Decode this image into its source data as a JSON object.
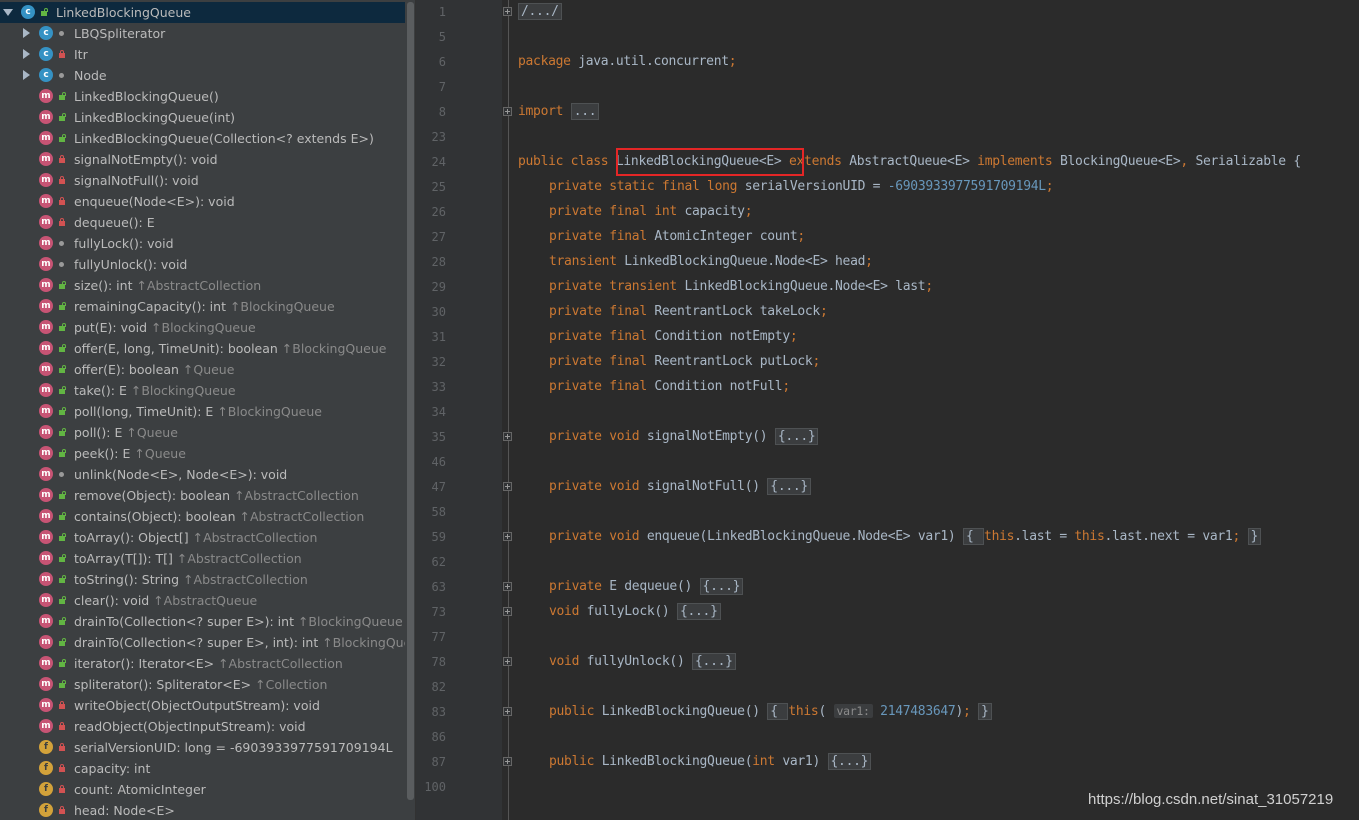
{
  "structure": {
    "items": [
      {
        "label": "LinkedBlockingQueue",
        "inherit": "",
        "kind": "c",
        "vis": "open",
        "depth": 0,
        "arrow": "down",
        "selected": true
      },
      {
        "label": "LBQSpliterator",
        "inherit": "",
        "kind": "c",
        "vis": "dot",
        "depth": 1,
        "arrow": "right"
      },
      {
        "label": "Itr",
        "inherit": "",
        "kind": "c",
        "vis": "lock",
        "depth": 1,
        "arrow": "right"
      },
      {
        "label": "Node",
        "inherit": "",
        "kind": "c",
        "vis": "dot",
        "depth": 1,
        "arrow": "right"
      },
      {
        "label": "LinkedBlockingQueue()",
        "inherit": "",
        "kind": "m",
        "vis": "open",
        "depth": 1
      },
      {
        "label": "LinkedBlockingQueue(int)",
        "inherit": "",
        "kind": "m",
        "vis": "open",
        "depth": 1
      },
      {
        "label": "LinkedBlockingQueue(Collection<? extends E>)",
        "inherit": "",
        "kind": "m",
        "vis": "open",
        "depth": 1
      },
      {
        "label": "signalNotEmpty(): void",
        "inherit": "",
        "kind": "m",
        "vis": "lock",
        "depth": 1
      },
      {
        "label": "signalNotFull(): void",
        "inherit": "",
        "kind": "m",
        "vis": "lock",
        "depth": 1
      },
      {
        "label": "enqueue(Node<E>): void",
        "inherit": "",
        "kind": "m",
        "vis": "lock",
        "depth": 1
      },
      {
        "label": "dequeue(): E",
        "inherit": "",
        "kind": "m",
        "vis": "lock",
        "depth": 1
      },
      {
        "label": "fullyLock(): void",
        "inherit": "",
        "kind": "m",
        "vis": "dot",
        "depth": 1
      },
      {
        "label": "fullyUnlock(): void",
        "inherit": "",
        "kind": "m",
        "vis": "dot",
        "depth": 1
      },
      {
        "label": "size(): int ",
        "inherit": "↑AbstractCollection",
        "kind": "m",
        "vis": "open",
        "depth": 1
      },
      {
        "label": "remainingCapacity(): int ",
        "inherit": "↑BlockingQueue",
        "kind": "m",
        "vis": "open",
        "depth": 1
      },
      {
        "label": "put(E): void ",
        "inherit": "↑BlockingQueue",
        "kind": "m",
        "vis": "open",
        "depth": 1
      },
      {
        "label": "offer(E, long, TimeUnit): boolean ",
        "inherit": "↑BlockingQueue",
        "kind": "m",
        "vis": "open",
        "depth": 1
      },
      {
        "label": "offer(E): boolean ",
        "inherit": "↑Queue",
        "kind": "m",
        "vis": "open",
        "depth": 1
      },
      {
        "label": "take(): E ",
        "inherit": "↑BlockingQueue",
        "kind": "m",
        "vis": "open",
        "depth": 1
      },
      {
        "label": "poll(long, TimeUnit): E ",
        "inherit": "↑BlockingQueue",
        "kind": "m",
        "vis": "open",
        "depth": 1
      },
      {
        "label": "poll(): E ",
        "inherit": "↑Queue",
        "kind": "m",
        "vis": "open",
        "depth": 1
      },
      {
        "label": "peek(): E ",
        "inherit": "↑Queue",
        "kind": "m",
        "vis": "open",
        "depth": 1
      },
      {
        "label": "unlink(Node<E>, Node<E>): void",
        "inherit": "",
        "kind": "m",
        "vis": "dot",
        "depth": 1
      },
      {
        "label": "remove(Object): boolean ",
        "inherit": "↑AbstractCollection",
        "kind": "m",
        "vis": "open",
        "depth": 1
      },
      {
        "label": "contains(Object): boolean ",
        "inherit": "↑AbstractCollection",
        "kind": "m",
        "vis": "open",
        "depth": 1
      },
      {
        "label": "toArray(): Object[] ",
        "inherit": "↑AbstractCollection",
        "kind": "m",
        "vis": "open",
        "depth": 1
      },
      {
        "label": "toArray(T[]): T[] ",
        "inherit": "↑AbstractCollection",
        "kind": "m",
        "vis": "open",
        "depth": 1
      },
      {
        "label": "toString(): String ",
        "inherit": "↑AbstractCollection",
        "kind": "m",
        "vis": "open",
        "depth": 1
      },
      {
        "label": "clear(): void ",
        "inherit": "↑AbstractQueue",
        "kind": "m",
        "vis": "open",
        "depth": 1
      },
      {
        "label": "drainTo(Collection<? super E>): int ",
        "inherit": "↑BlockingQueue",
        "kind": "m",
        "vis": "open",
        "depth": 1
      },
      {
        "label": "drainTo(Collection<? super E>, int): int ",
        "inherit": "↑BlockingQueue",
        "kind": "m",
        "vis": "open",
        "depth": 1
      },
      {
        "label": "iterator(): Iterator<E> ",
        "inherit": "↑AbstractCollection",
        "kind": "m",
        "vis": "open",
        "depth": 1
      },
      {
        "label": "spliterator(): Spliterator<E> ",
        "inherit": "↑Collection",
        "kind": "m",
        "vis": "open",
        "depth": 1
      },
      {
        "label": "writeObject(ObjectOutputStream): void",
        "inherit": "",
        "kind": "m",
        "vis": "lock",
        "depth": 1
      },
      {
        "label": "readObject(ObjectInputStream): void",
        "inherit": "",
        "kind": "m",
        "vis": "lock",
        "depth": 1
      },
      {
        "label": "serialVersionUID: long = -6903933977591709194L",
        "inherit": "",
        "kind": "f",
        "vis": "lock",
        "depth": 1
      },
      {
        "label": "capacity: int",
        "inherit": "",
        "kind": "f",
        "vis": "lock",
        "depth": 1
      },
      {
        "label": "count: AtomicInteger",
        "inherit": "",
        "kind": "f",
        "vis": "lock",
        "depth": 1
      },
      {
        "label": "head: Node<E>",
        "inherit": "",
        "kind": "f",
        "vis": "lock",
        "depth": 1
      }
    ]
  },
  "editor": {
    "lines": [
      {
        "num": "1",
        "fold": true,
        "indent": 0,
        "tokens": [
          {
            "t": "/.../",
            "c": "fbox"
          }
        ]
      },
      {
        "num": "5",
        "indent": 0,
        "tokens": []
      },
      {
        "num": "6",
        "indent": 0,
        "tokens": [
          {
            "t": "package",
            "c": "kw"
          },
          {
            "t": " java.util.concurrent"
          },
          {
            "t": ";",
            "c": "kw"
          }
        ]
      },
      {
        "num": "7",
        "indent": 0,
        "tokens": []
      },
      {
        "num": "8",
        "fold": true,
        "indent": 0,
        "tokens": [
          {
            "t": "import",
            "c": "kw"
          },
          {
            "t": " "
          },
          {
            "t": "...",
            "c": "fbox"
          }
        ]
      },
      {
        "num": "23",
        "indent": 0,
        "tokens": []
      },
      {
        "num": "24",
        "indent": 0,
        "tokens": [
          {
            "t": "public class ",
            "c": "kw"
          },
          {
            "t": "LinkedBlockingQueue<E> "
          },
          {
            "t": "extends ",
            "c": "kw"
          },
          {
            "t": "AbstractQueue<E> "
          },
          {
            "t": "implements ",
            "c": "kw"
          },
          {
            "t": "BlockingQueue<E>"
          },
          {
            "t": ", ",
            "c": "kw"
          },
          {
            "t": "Serializable {"
          }
        ]
      },
      {
        "num": "25",
        "indent": 1,
        "tokens": [
          {
            "t": "private static final long ",
            "c": "kw"
          },
          {
            "t": "serialVersionUID = "
          },
          {
            "t": "-6903933977591709194L",
            "c": "num"
          },
          {
            "t": ";",
            "c": "kw"
          }
        ]
      },
      {
        "num": "26",
        "indent": 1,
        "tokens": [
          {
            "t": "private final int ",
            "c": "kw"
          },
          {
            "t": "capacity"
          },
          {
            "t": ";",
            "c": "kw"
          }
        ]
      },
      {
        "num": "27",
        "indent": 1,
        "tokens": [
          {
            "t": "private final ",
            "c": "kw"
          },
          {
            "t": "AtomicInteger count"
          },
          {
            "t": ";",
            "c": "kw"
          }
        ]
      },
      {
        "num": "28",
        "indent": 1,
        "tokens": [
          {
            "t": "transient ",
            "c": "kw"
          },
          {
            "t": "LinkedBlockingQueue.Node<E> head"
          },
          {
            "t": ";",
            "c": "kw"
          }
        ]
      },
      {
        "num": "29",
        "indent": 1,
        "tokens": [
          {
            "t": "private transient ",
            "c": "kw"
          },
          {
            "t": "LinkedBlockingQueue.Node<E> last"
          },
          {
            "t": ";",
            "c": "kw"
          }
        ]
      },
      {
        "num": "30",
        "indent": 1,
        "tokens": [
          {
            "t": "private final ",
            "c": "kw"
          },
          {
            "t": "ReentrantLock takeLock"
          },
          {
            "t": ";",
            "c": "kw"
          }
        ]
      },
      {
        "num": "31",
        "indent": 1,
        "tokens": [
          {
            "t": "private final ",
            "c": "kw"
          },
          {
            "t": "Condition notEmpty"
          },
          {
            "t": ";",
            "c": "kw"
          }
        ]
      },
      {
        "num": "32",
        "indent": 1,
        "tokens": [
          {
            "t": "private final ",
            "c": "kw"
          },
          {
            "t": "ReentrantLock putLock"
          },
          {
            "t": ";",
            "c": "kw"
          }
        ]
      },
      {
        "num": "33",
        "indent": 1,
        "tokens": [
          {
            "t": "private final ",
            "c": "kw"
          },
          {
            "t": "Condition notFull"
          },
          {
            "t": ";",
            "c": "kw"
          }
        ]
      },
      {
        "num": "34",
        "indent": 0,
        "tokens": []
      },
      {
        "num": "35",
        "fold": true,
        "indent": 1,
        "tokens": [
          {
            "t": "private void ",
            "c": "kw"
          },
          {
            "t": "signalNotEmpty() "
          },
          {
            "t": "{...}",
            "c": "fbox"
          }
        ]
      },
      {
        "num": "46",
        "indent": 0,
        "tokens": []
      },
      {
        "num": "47",
        "fold": true,
        "indent": 1,
        "tokens": [
          {
            "t": "private void ",
            "c": "kw"
          },
          {
            "t": "signalNotFull() "
          },
          {
            "t": "{...}",
            "c": "fbox"
          }
        ]
      },
      {
        "num": "58",
        "indent": 0,
        "tokens": []
      },
      {
        "num": "59",
        "fold": true,
        "indent": 1,
        "tokens": [
          {
            "t": "private void ",
            "c": "kw"
          },
          {
            "t": "enqueue(LinkedBlockingQueue.Node<E> var1) "
          },
          {
            "t": "{ ",
            "c": "fbox"
          },
          {
            "t": "this",
            "c": "kw"
          },
          {
            "t": ".last = "
          },
          {
            "t": "this",
            "c": "kw"
          },
          {
            "t": ".last.next = var1"
          },
          {
            "t": ";",
            "c": "kw"
          },
          {
            "t": " "
          },
          {
            "t": "}",
            "c": "fbox"
          }
        ]
      },
      {
        "num": "62",
        "indent": 0,
        "tokens": []
      },
      {
        "num": "63",
        "fold": true,
        "indent": 1,
        "tokens": [
          {
            "t": "private ",
            "c": "kw"
          },
          {
            "t": "E dequeue() "
          },
          {
            "t": "{...}",
            "c": "fbox"
          }
        ]
      },
      {
        "num": "73",
        "fold": true,
        "indent": 1,
        "tokens": [
          {
            "t": "void ",
            "c": "kw"
          },
          {
            "t": "fullyLock() "
          },
          {
            "t": "{...}",
            "c": "fbox"
          }
        ]
      },
      {
        "num": "77",
        "indent": 0,
        "tokens": []
      },
      {
        "num": "78",
        "fold": true,
        "indent": 1,
        "tokens": [
          {
            "t": "void ",
            "c": "kw"
          },
          {
            "t": "fullyUnlock() "
          },
          {
            "t": "{...}",
            "c": "fbox"
          }
        ]
      },
      {
        "num": "82",
        "indent": 0,
        "tokens": []
      },
      {
        "num": "83",
        "fold": true,
        "indent": 1,
        "tokens": [
          {
            "t": "public ",
            "c": "kw"
          },
          {
            "t": "LinkedBlockingQueue() "
          },
          {
            "t": "{ ",
            "c": "fbox"
          },
          {
            "t": "this",
            "c": "kw"
          },
          {
            "t": "( "
          },
          {
            "t": "var1:",
            "c": "hint"
          },
          {
            "t": " "
          },
          {
            "t": "2147483647",
            "c": "num"
          },
          {
            "t": ")"
          },
          {
            "t": ";",
            "c": "kw"
          },
          {
            "t": " "
          },
          {
            "t": "}",
            "c": "fbox"
          }
        ]
      },
      {
        "num": "86",
        "indent": 0,
        "tokens": []
      },
      {
        "num": "87",
        "fold": true,
        "indent": 1,
        "tokens": [
          {
            "t": "public ",
            "c": "kw"
          },
          {
            "t": "LinkedBlockingQueue("
          },
          {
            "t": "int ",
            "c": "kw"
          },
          {
            "t": "var1) "
          },
          {
            "t": "{...}",
            "c": "fbox"
          }
        ]
      },
      {
        "num": "100",
        "indent": 0,
        "tokens": []
      }
    ]
  },
  "watermark": "https://blog.csdn.net/sinat_31057219"
}
